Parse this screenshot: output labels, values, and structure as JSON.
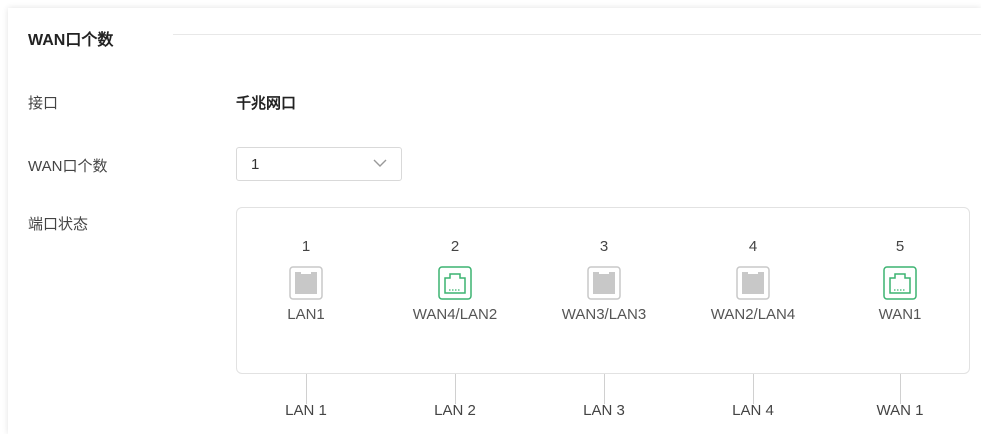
{
  "section": {
    "title": "WAN口个数"
  },
  "rows": {
    "interface_label": "接口",
    "interface_value": "千兆网口",
    "wan_count_label": "WAN口个数",
    "wan_count_value": "1",
    "port_status_label": "端口状态"
  },
  "ports": [
    {
      "number": "1",
      "label": "LAN1",
      "icon": "ethernet-port-inactive-icon",
      "active": false,
      "bottom": "LAN 1"
    },
    {
      "number": "2",
      "label": "WAN4/LAN2",
      "icon": "ethernet-port-active-icon",
      "active": true,
      "bottom": "LAN 2"
    },
    {
      "number": "3",
      "label": "WAN3/LAN3",
      "icon": "ethernet-port-inactive-icon",
      "active": false,
      "bottom": "LAN 3"
    },
    {
      "number": "4",
      "label": "WAN2/LAN4",
      "icon": "ethernet-port-inactive-icon",
      "active": false,
      "bottom": "LAN 4"
    },
    {
      "number": "5",
      "label": "WAN1",
      "icon": "ethernet-port-active-icon",
      "active": true,
      "bottom": "WAN 1"
    }
  ],
  "colors": {
    "active_port": "#3cb371",
    "inactive_port": "#c8c8c8"
  }
}
